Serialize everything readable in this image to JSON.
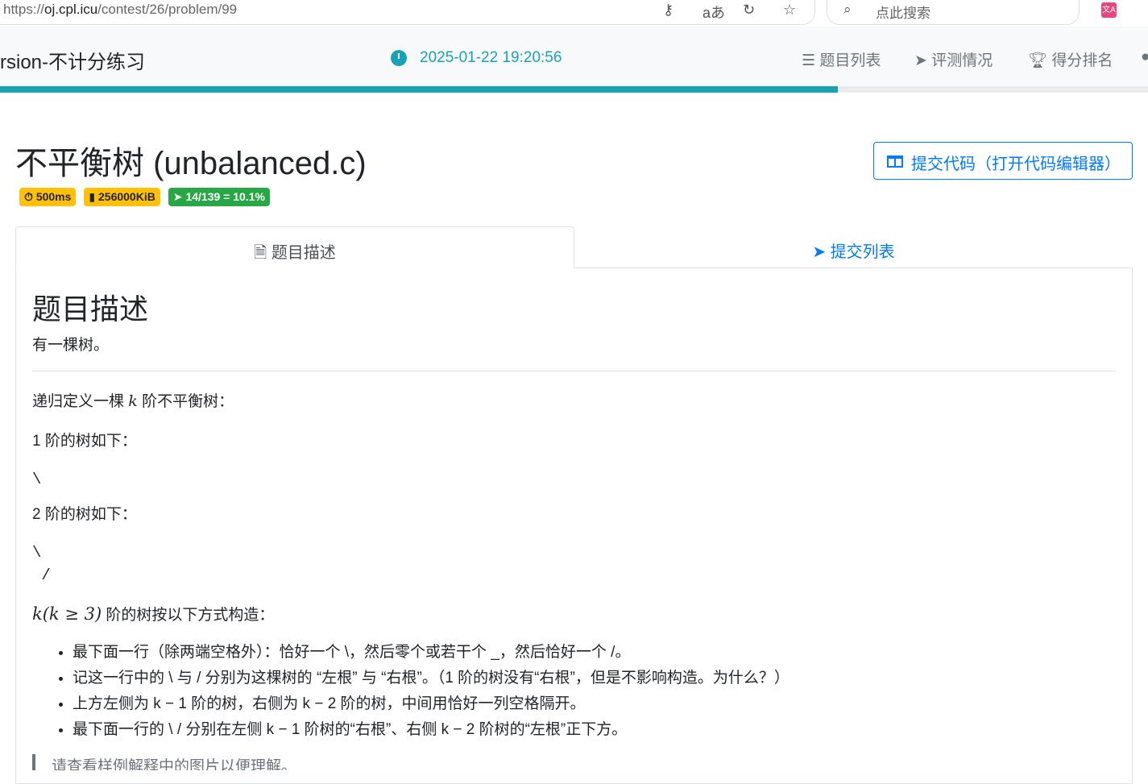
{
  "browser": {
    "url_prefix": "https://",
    "url_host": "oj.cpl.icu",
    "url_path": "/contest/26/problem/99",
    "search_placeholder": "点此搜索",
    "ext_label": "文A"
  },
  "nav": {
    "contest_title": "rsion-不计分练习",
    "time": "2025-01-22 19:20:56",
    "items": [
      {
        "label": "题目列表"
      },
      {
        "label": "评测情况"
      },
      {
        "label": "得分排名"
      }
    ],
    "progress_percent": 73
  },
  "problem": {
    "title": "不平衡树 (unbalanced.c)",
    "time_limit": "500ms",
    "memory_limit": "256000KiB",
    "accept": "14/139 = 10.1%",
    "submit_label": "提交代码（打开代码编辑器）"
  },
  "tabs": [
    {
      "label": "题目描述"
    },
    {
      "label": "提交列表"
    }
  ],
  "desc": {
    "heading": "题目描述",
    "intro": "有一棵树。",
    "def": [
      "递归定义一棵 ",
      "k",
      " 阶不平衡树："
    ],
    "order1": "1 阶的树如下：",
    "tree1": "\\",
    "order2": "2 阶的树如下：",
    "tree2": "\\\n /",
    "orderk": [
      "k(k ≥ 3)",
      " 阶的树按以下方式构造："
    ],
    "bullets": [
      "最下面一行（除两端空格外）：恰好一个 \\，然后零个或若干个 _，然后恰好一个 /。",
      "记这一行中的 \\ 与 / 分别为这棵树的 “左根” 与 “右根”。（1 阶的树没有“右根”，但是不影响构造。为什么？）",
      "上方左侧为 k − 1 阶的树，右侧为 k − 2 阶的树，中间用恰好一列空格隔开。",
      "最下面一行的 \\ / 分别在左侧 k − 1 阶树的“右根”、右侧 k − 2 阶树的“左根”正下方。"
    ],
    "note": "请查看样例解释中的图片以便理解。"
  }
}
